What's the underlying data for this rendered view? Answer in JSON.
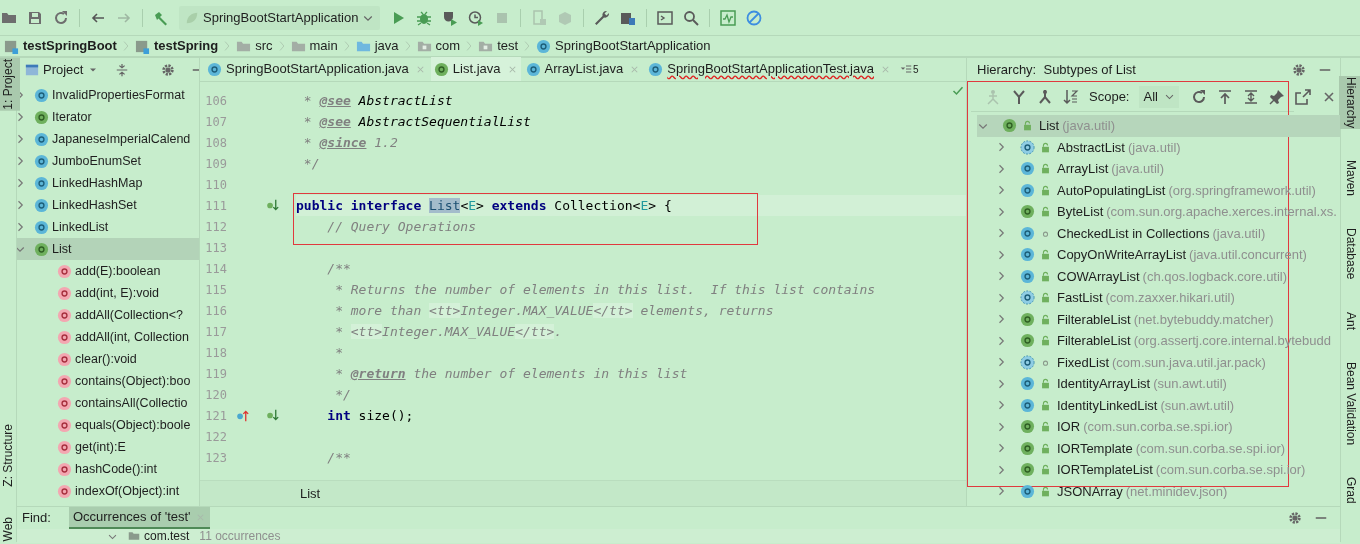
{
  "toolbar": {
    "buttons": [
      {
        "disabled": false
      },
      {
        "disabled": false
      },
      {
        "disabled": false
      },
      {
        "disabled": false
      },
      {
        "disabled": true
      },
      {
        "disabled": false
      },
      {
        "disabled": false
      },
      {
        "disabled": false
      },
      {
        "disabled": false
      },
      {
        "disabled": false
      },
      {
        "disabled": true
      },
      {
        "disabled": true
      },
      {
        "disabled": true
      },
      {
        "disabled": false
      },
      {
        "disabled": false
      },
      {
        "disabled": false
      },
      {
        "disabled": false
      },
      {
        "disabled": false
      },
      {
        "disabled": false
      }
    ],
    "run_config": "SpringBootStartApplication"
  },
  "breadcrumbs": [
    {
      "label": "testSpringBoot",
      "kind": "module"
    },
    {
      "label": "testSpring",
      "kind": "module"
    },
    {
      "label": "src",
      "kind": "folder"
    },
    {
      "label": "main",
      "kind": "folder"
    },
    {
      "label": "java",
      "kind": "source-folder"
    },
    {
      "label": "com",
      "kind": "package"
    },
    {
      "label": "test",
      "kind": "package"
    },
    {
      "label": "SpringBootStartApplication",
      "kind": "class"
    }
  ],
  "left_stripe": [
    {
      "label": "1: Project",
      "selected": true
    },
    {
      "label": "Z: Structure",
      "selected": false
    },
    {
      "label": "Web",
      "selected": false
    }
  ],
  "project_panel": {
    "title": "Project",
    "items": [
      {
        "label": "InvalidPropertiesFormat",
        "kind": "class",
        "expanded": false,
        "selected": false
      },
      {
        "label": "Iterator",
        "kind": "interface",
        "expanded": false,
        "selected": false
      },
      {
        "label": "JapaneseImperialCalend",
        "kind": "class",
        "expanded": false,
        "selected": false
      },
      {
        "label": "JumboEnumSet",
        "kind": "class",
        "expanded": false,
        "selected": false
      },
      {
        "label": "LinkedHashMap",
        "kind": "class",
        "expanded": false,
        "selected": false
      },
      {
        "label": "LinkedHashSet",
        "kind": "class",
        "expanded": false,
        "selected": false
      },
      {
        "label": "LinkedList",
        "kind": "class",
        "expanded": false,
        "selected": false
      },
      {
        "label": "List",
        "kind": "interface",
        "expanded": true,
        "selected": true,
        "children": [
          {
            "label": "add(E):boolean",
            "selected": false
          },
          {
            "label": "add(int, E):void",
            "selected": false
          },
          {
            "label": "addAll(Collection<?",
            "selected": false
          },
          {
            "label": "addAll(int, Collection",
            "selected": false
          },
          {
            "label": "clear():void",
            "selected": false
          },
          {
            "label": "contains(Object):boo",
            "selected": false
          },
          {
            "label": "containsAll(Collectio",
            "selected": false
          },
          {
            "label": "equals(Object):boole",
            "selected": false
          },
          {
            "label": "get(int):E",
            "selected": false
          },
          {
            "label": "hashCode():int",
            "selected": false
          },
          {
            "label": "indexOf(Object):int",
            "selected": false
          }
        ]
      }
    ]
  },
  "editor": {
    "tabs": [
      {
        "label": "SpringBootStartApplication.java",
        "kind": "class",
        "selected": false,
        "error": false
      },
      {
        "label": "List.java",
        "kind": "interface",
        "selected": true,
        "error": false
      },
      {
        "label": "ArrayList.java",
        "kind": "class",
        "selected": false,
        "error": false
      },
      {
        "label": "SpringBootStartApplicationTest.java",
        "kind": "class",
        "selected": false,
        "error": true
      }
    ],
    "hidden_tabs": "5",
    "lines": [
      {
        "number": "106",
        "segments": [
          {
            "text": " * ",
            "kind": "comment"
          },
          {
            "text": "@see",
            "kind": "doc-tag"
          },
          {
            "text": " AbstractList",
            "kind": "doc-ref"
          }
        ]
      },
      {
        "number": "107",
        "segments": [
          {
            "text": " * ",
            "kind": "comment"
          },
          {
            "text": "@see",
            "kind": "doc-tag"
          },
          {
            "text": " AbstractSequentialList",
            "kind": "doc-ref"
          }
        ]
      },
      {
        "number": "108",
        "segments": [
          {
            "text": " * ",
            "kind": "comment"
          },
          {
            "text": "@since",
            "kind": "doc-tag"
          },
          {
            "text": " 1.2",
            "kind": "comment"
          }
        ]
      },
      {
        "number": "109",
        "segments": [
          {
            "text": " */",
            "kind": "comment"
          }
        ]
      },
      {
        "number": "110"
      },
      {
        "number": "111",
        "current": true,
        "gutter": [
          {
            "kind": "implemented"
          }
        ],
        "segments": [
          {
            "text": "public interface ",
            "kind": "keyword"
          },
          {
            "text": "List",
            "kind": "selection"
          },
          {
            "text": "<",
            "kind": "plain"
          },
          {
            "text": "E",
            "kind": "type-param"
          },
          {
            "text": "> ",
            "kind": "plain"
          },
          {
            "text": "extends ",
            "kind": "keyword"
          },
          {
            "text": "Collection<",
            "kind": "plain"
          },
          {
            "text": "E",
            "kind": "type-param"
          },
          {
            "text": "> {",
            "kind": "plain"
          }
        ]
      },
      {
        "number": "112",
        "segments": [
          {
            "text": "    // Query Operations",
            "kind": "comment"
          }
        ]
      },
      {
        "number": "113"
      },
      {
        "number": "114",
        "segments": [
          {
            "text": "    /**",
            "kind": "comment"
          }
        ]
      },
      {
        "number": "115",
        "segments": [
          {
            "text": "     * Returns the number of elements in this list.  If this list contains",
            "kind": "comment"
          }
        ]
      },
      {
        "number": "116",
        "segments": [
          {
            "text": "     * more than ",
            "kind": "comment"
          },
          {
            "text": "<tt>",
            "kind": "html"
          },
          {
            "text": "Integer.MAX_VALUE",
            "kind": "comment"
          },
          {
            "text": "</tt>",
            "kind": "html"
          },
          {
            "text": " elements, returns",
            "kind": "comment"
          }
        ]
      },
      {
        "number": "117",
        "segments": [
          {
            "text": "     * ",
            "kind": "comment"
          },
          {
            "text": "<tt>",
            "kind": "html"
          },
          {
            "text": "Integer.MAX_VALUE",
            "kind": "comment"
          },
          {
            "text": "</tt>",
            "kind": "html"
          },
          {
            "text": ".",
            "kind": "comment"
          }
        ]
      },
      {
        "number": "118",
        "segments": [
          {
            "text": "     *",
            "kind": "comment"
          }
        ]
      },
      {
        "number": "119",
        "segments": [
          {
            "text": "     * ",
            "kind": "comment"
          },
          {
            "text": "@return",
            "kind": "doc-tag"
          },
          {
            "text": " the number of elements in this list",
            "kind": "comment"
          }
        ]
      },
      {
        "number": "120",
        "segments": [
          {
            "text": "     */",
            "kind": "comment"
          }
        ]
      },
      {
        "number": "121",
        "gutter": [
          {
            "kind": "overrides"
          },
          {
            "kind": "implemented"
          }
        ],
        "segments": [
          {
            "text": "    int",
            "kind": "keyword"
          },
          {
            "text": " size();",
            "kind": "plain"
          }
        ]
      },
      {
        "number": "122"
      },
      {
        "number": "123",
        "segments": [
          {
            "text": "    /**",
            "kind": "comment"
          }
        ]
      }
    ],
    "breadcrumb": "List"
  },
  "hierarchy": {
    "title": "Hierarchy:  Subtypes of List",
    "toolbar": [
      {
        "disabled": true
      },
      {
        "disabled": false
      },
      {
        "disabled": false
      },
      {
        "disabled": false
      },
      {
        "disabled": false
      },
      {
        "disabled": false
      },
      {
        "disabled": false
      },
      {
        "disabled": false
      },
      {
        "disabled": false
      },
      {
        "disabled": false
      }
    ],
    "scope_label": "Scope:",
    "scope": "All",
    "root": {
      "name": "List",
      "package": "(java.util)",
      "kind": "interface",
      "modifier": {
        "kind": "public"
      },
      "expanded": true,
      "selected": true,
      "children": [
        {
          "name": "AbstractList",
          "package": "(java.util)",
          "kind": "abstract-class",
          "modifier": {
            "kind": "public"
          },
          "expanded": false,
          "selected": false
        },
        {
          "name": "ArrayList",
          "package": "(java.util)",
          "kind": "class",
          "modifier": {
            "kind": "public"
          },
          "expanded": false,
          "selected": false
        },
        {
          "name": "AutoPopulatingList",
          "package": "(org.springframework.util)",
          "kind": "class",
          "modifier": {
            "kind": "public"
          },
          "expanded": false,
          "selected": false
        },
        {
          "name": "ByteList",
          "package": "(com.sun.org.apache.xerces.internal.xs.",
          "kind": "interface",
          "modifier": {
            "kind": "public"
          },
          "expanded": false,
          "selected": false
        },
        {
          "name": "CheckedList in Collections",
          "package": "(java.util)",
          "kind": "class",
          "modifier": {
            "kind": "package"
          },
          "expanded": false,
          "selected": false
        },
        {
          "name": "CopyOnWriteArrayList",
          "package": "(java.util.concurrent)",
          "kind": "class",
          "modifier": {
            "kind": "public"
          },
          "expanded": false,
          "selected": false
        },
        {
          "name": "COWArrayList",
          "package": "(ch.qos.logback.core.util)",
          "kind": "class",
          "modifier": {
            "kind": "public"
          },
          "expanded": false,
          "selected": false
        },
        {
          "name": "FastList",
          "package": "(com.zaxxer.hikari.util)",
          "kind": "abstract-class",
          "modifier": {
            "kind": "public"
          },
          "expanded": false,
          "selected": false
        },
        {
          "name": "FilterableList",
          "package": "(net.bytebuddy.matcher)",
          "kind": "interface",
          "modifier": {
            "kind": "public"
          },
          "expanded": false,
          "selected": false
        },
        {
          "name": "FilterableList",
          "package": "(org.assertj.core.internal.bytebudd",
          "kind": "interface",
          "modifier": {
            "kind": "public"
          },
          "expanded": false,
          "selected": false
        },
        {
          "name": "FixedList",
          "package": "(com.sun.java.util.jar.pack)",
          "kind": "abstract-class",
          "modifier": {
            "kind": "package"
          },
          "expanded": false,
          "selected": false
        },
        {
          "name": "IdentityArrayList",
          "package": "(sun.awt.util)",
          "kind": "class",
          "modifier": {
            "kind": "public"
          },
          "expanded": false,
          "selected": false
        },
        {
          "name": "IdentityLinkedList",
          "package": "(sun.awt.util)",
          "kind": "class",
          "modifier": {
            "kind": "public"
          },
          "expanded": false,
          "selected": false
        },
        {
          "name": "IOR",
          "package": "(com.sun.corba.se.spi.ior)",
          "kind": "interface",
          "modifier": {
            "kind": "public"
          },
          "expanded": false,
          "selected": false
        },
        {
          "name": "IORTemplate",
          "package": "(com.sun.corba.se.spi.ior)",
          "kind": "interface",
          "modifier": {
            "kind": "public"
          },
          "expanded": false,
          "selected": false
        },
        {
          "name": "IORTemplateList",
          "package": "(com.sun.corba.se.spi.ior)",
          "kind": "interface",
          "modifier": {
            "kind": "public"
          },
          "expanded": false,
          "selected": false
        },
        {
          "name": "JSONArray",
          "package": "(net.minidev.json)",
          "kind": "class",
          "modifier": {
            "kind": "public"
          },
          "expanded": false,
          "selected": false
        }
      ]
    }
  },
  "right_stripe": [
    {
      "label": "Hierarchy",
      "selected": true
    },
    {
      "label": "Maven",
      "selected": false
    },
    {
      "label": "Database",
      "selected": false
    },
    {
      "label": "Ant",
      "selected": false
    },
    {
      "label": "Bean Validation",
      "selected": false
    },
    {
      "label": "Grad",
      "selected": false
    }
  ],
  "find": {
    "label": "Find:",
    "tab": {
      "label": "Occurrences of 'test'",
      "selected": true
    },
    "result": {
      "package": "com.test",
      "count": "11 occurrences",
      "expanded": true
    }
  }
}
